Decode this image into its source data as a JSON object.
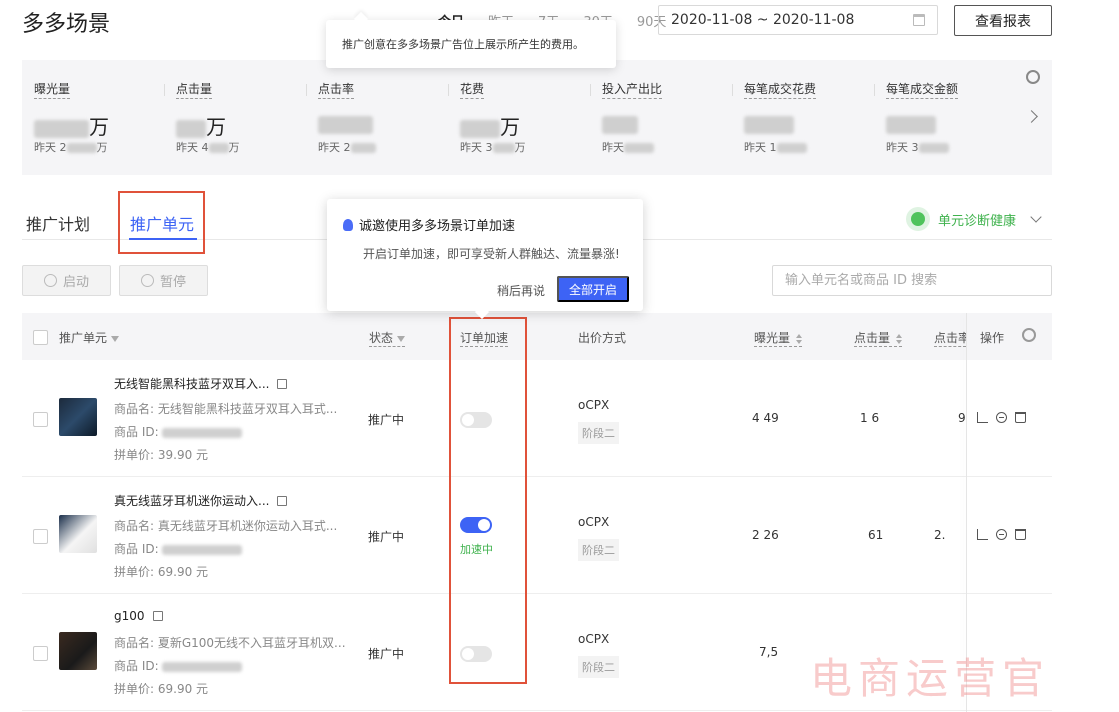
{
  "page": {
    "title": "多多场景"
  },
  "range_tabs": [
    "今日",
    "昨天",
    "7天",
    "30天",
    "90天"
  ],
  "date_range": "2020-11-08 ~ 2020-11-08",
  "report_button": "查看报表",
  "tooltip_spend": "推广创意在多多场景广告位上展示所产生的费用。",
  "metrics": [
    {
      "label": "曝光量",
      "value_suffix": "万",
      "yesterday_prefix": "昨天 2",
      "yesterday_suffix": "万"
    },
    {
      "label": "点击量",
      "value_suffix": "万",
      "yesterday_prefix": "昨天 4",
      "yesterday_suffix": "万"
    },
    {
      "label": "点击率",
      "value_suffix": "",
      "yesterday_prefix": "昨天 2",
      "yesterday_suffix": ""
    },
    {
      "label": "花费",
      "value_suffix": "万",
      "yesterday_prefix": "昨天 3",
      "yesterday_suffix": "万"
    },
    {
      "label": "投入产出比",
      "value_suffix": "",
      "yesterday_prefix": "昨天",
      "yesterday_suffix": ""
    },
    {
      "label": "每笔成交花费",
      "value_suffix": "",
      "yesterday_prefix": "昨天 1",
      "yesterday_suffix": ""
    },
    {
      "label": "每笔成交金额",
      "value_suffix": "",
      "yesterday_prefix": "昨天 3",
      "yesterday_suffix": ""
    }
  ],
  "tabs": [
    "推广计划",
    "推广单元"
  ],
  "diagnosis_label": "单元诊断健康",
  "popover": {
    "title": "诚邀使用多多场景订单加速",
    "body": "开启订单加速，即可享受新人群触达、流量暴涨!",
    "later": "稍后再说",
    "enable_all": "全部开启"
  },
  "toolbar": {
    "start": "启动",
    "pause": "暂停",
    "search_placeholder": "输入单元名或商品 ID 搜索"
  },
  "columns": {
    "unit": "推广单元",
    "status": "状态",
    "accel": "订单加速",
    "bid": "出价方式",
    "impressions": "曝光量",
    "clicks": "点击量",
    "ctr": "点击率",
    "ops": "操作"
  },
  "rows": [
    {
      "title": "无线智能黑科技蓝牙双耳入...",
      "goods_name": "商品名: 无线智能黑科技蓝牙双耳入耳式...",
      "goods_id_label": "商品 ID:",
      "price": "拼单价: 39.90 元",
      "status": "推广中",
      "accel_on": false,
      "accel_text": "",
      "bid": "oCPX",
      "stage": "阶段二",
      "impressions": "4 49",
      "clicks": "1 6",
      "ctr": "9"
    },
    {
      "title": "真无线蓝牙耳机迷你运动入...",
      "goods_name": "商品名: 真无线蓝牙耳机迷你运动入耳式...",
      "goods_id_label": "商品 ID:",
      "price": "拼单价: 69.90 元",
      "status": "推广中",
      "accel_on": true,
      "accel_text": "加速中",
      "bid": "oCPX",
      "stage": "阶段二",
      "impressions": "2 26",
      "clicks": "61",
      "ctr": "2."
    },
    {
      "title": "g100",
      "goods_name": "商品名: 夏新G100无线不入耳蓝牙耳机双...",
      "goods_id_label": "商品 ID:",
      "price": "拼单价: 69.90 元",
      "status": "推广中",
      "accel_on": false,
      "accel_text": "",
      "bid": "oCPX",
      "stage": "阶段二",
      "impressions": "7,5",
      "clicks": "",
      "ctr": ""
    }
  ],
  "watermark": "电商运营官"
}
